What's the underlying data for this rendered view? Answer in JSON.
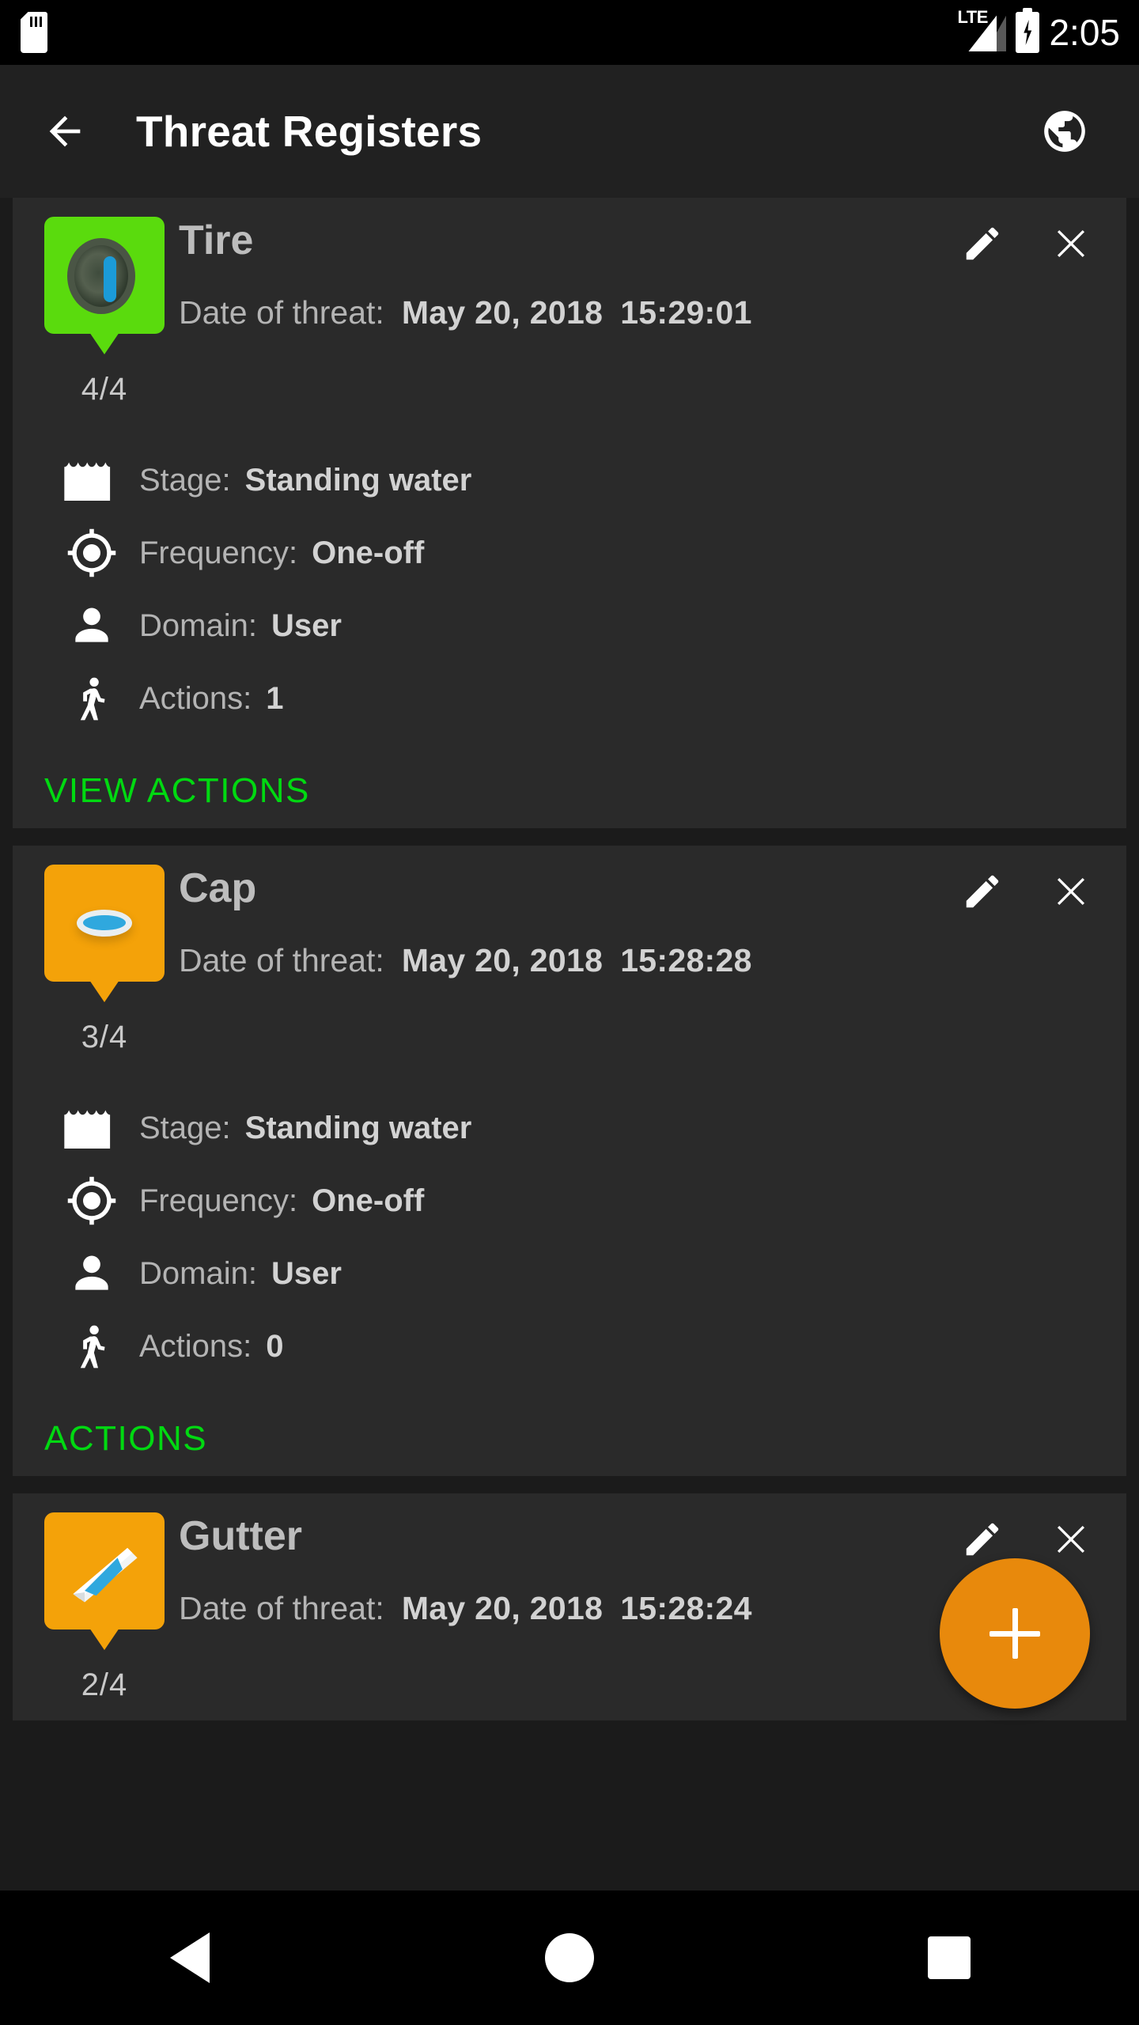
{
  "statusbar": {
    "sd_icon": "sd-card-icon",
    "network_label": "LTE",
    "signal_icon": "signal-bars-icon",
    "battery_icon": "battery-charging-icon",
    "time": "2:05"
  },
  "appbar": {
    "back_icon": "back-arrow-icon",
    "title": "Threat Registers",
    "globe_icon": "globe-icon"
  },
  "cards": [
    {
      "name": "Tire",
      "pin_color": "#5ADB0D",
      "pin_count": "4/4",
      "thumb_icon": "tire-icon",
      "edit_icon": "pencil-icon",
      "close_icon": "close-icon",
      "date_label": "Date of threat:",
      "date_value": "May 20, 2018",
      "time_value": "15:29:01",
      "details": [
        {
          "icon": "standing-water-icon",
          "label": "Stage:",
          "value": "Standing water"
        },
        {
          "icon": "crosshair-icon",
          "label": "Frequency:",
          "value": "One-off"
        },
        {
          "icon": "person-icon",
          "label": "Domain:",
          "value": "User"
        },
        {
          "icon": "walking-person-icon",
          "label": "Actions:",
          "value": "1"
        }
      ],
      "link_label": "VIEW ACTIONS"
    },
    {
      "name": "Cap",
      "pin_color": "#F4A209",
      "pin_count": "3/4",
      "thumb_icon": "bottle-cap-icon",
      "edit_icon": "pencil-icon",
      "close_icon": "close-icon",
      "date_label": "Date of threat:",
      "date_value": "May 20, 2018",
      "time_value": "15:28:28",
      "details": [
        {
          "icon": "standing-water-icon",
          "label": "Stage:",
          "value": "Standing water"
        },
        {
          "icon": "crosshair-icon",
          "label": "Frequency:",
          "value": "One-off"
        },
        {
          "icon": "person-icon",
          "label": "Domain:",
          "value": "User"
        },
        {
          "icon": "walking-person-icon",
          "label": "Actions:",
          "value": "0"
        }
      ],
      "link_label": "ACTIONS"
    },
    {
      "name": "Gutter",
      "pin_color": "#F4A209",
      "pin_count": "2/4",
      "thumb_icon": "gutter-icon",
      "edit_icon": "pencil-icon",
      "close_icon": "close-icon",
      "date_label": "Date of threat:",
      "date_value": "May 20, 2018",
      "time_value": "15:28:24"
    }
  ],
  "fab": {
    "icon": "plus-icon",
    "color": "#E8890C"
  },
  "navbar": {
    "back_icon": "nav-back-icon",
    "home_icon": "nav-home-icon",
    "recents_icon": "nav-recents-icon"
  },
  "colors": {
    "accent_green": "#00D911",
    "accent_orange": "#E8890C",
    "card_bg": "#2a2a2a",
    "appbar_bg": "#212121"
  }
}
